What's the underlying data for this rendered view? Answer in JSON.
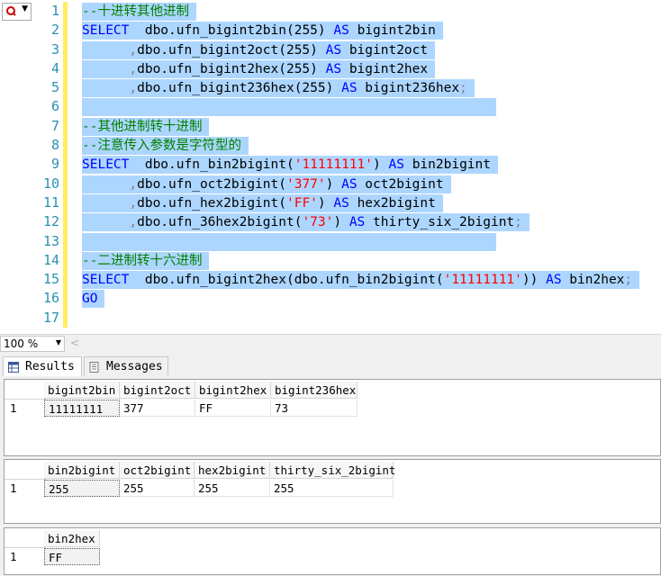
{
  "editor": {
    "lines": [
      {
        "n": "1",
        "segments": [
          {
            "t": "--十进转其他进制",
            "c": "cm"
          }
        ]
      },
      {
        "n": "2",
        "segments": [
          {
            "t": "SELECT",
            "c": "kw"
          },
          {
            "t": "  dbo.ufn_bigint2bin(255) ",
            "c": ""
          },
          {
            "t": "AS",
            "c": "kw"
          },
          {
            "t": " bigint2bin",
            "c": ""
          }
        ]
      },
      {
        "n": "3",
        "segments": [
          {
            "t": "      ,",
            "c": "op"
          },
          {
            "t": "dbo.ufn_bigint2oct(255) ",
            "c": ""
          },
          {
            "t": "AS",
            "c": "kw"
          },
          {
            "t": " bigint2oct",
            "c": ""
          }
        ]
      },
      {
        "n": "4",
        "segments": [
          {
            "t": "      ,",
            "c": "op"
          },
          {
            "t": "dbo.ufn_bigint2hex(255) ",
            "c": ""
          },
          {
            "t": "AS",
            "c": "kw"
          },
          {
            "t": " bigint2hex",
            "c": ""
          }
        ]
      },
      {
        "n": "5",
        "segments": [
          {
            "t": "      ,",
            "c": "op"
          },
          {
            "t": "dbo.ufn_bigint236hex(255) ",
            "c": ""
          },
          {
            "t": "AS",
            "c": "kw"
          },
          {
            "t": " bigint236hex",
            "c": ""
          },
          {
            "t": ";",
            "c": "op"
          }
        ]
      },
      {
        "n": "6",
        "segments": []
      },
      {
        "n": "7",
        "segments": [
          {
            "t": "--其他进制转十进制",
            "c": "cm"
          }
        ]
      },
      {
        "n": "8",
        "segments": [
          {
            "t": "--注意传入参数是字符型的",
            "c": "cm"
          }
        ]
      },
      {
        "n": "9",
        "segments": [
          {
            "t": "SELECT",
            "c": "kw"
          },
          {
            "t": "  dbo.ufn_bin2bigint(",
            "c": ""
          },
          {
            "t": "'11111111'",
            "c": "str"
          },
          {
            "t": ") ",
            "c": ""
          },
          {
            "t": "AS",
            "c": "kw"
          },
          {
            "t": " bin2bigint",
            "c": ""
          }
        ]
      },
      {
        "n": "10",
        "segments": [
          {
            "t": "      ,",
            "c": "op"
          },
          {
            "t": "dbo.ufn_oct2bigint(",
            "c": ""
          },
          {
            "t": "'377'",
            "c": "str"
          },
          {
            "t": ") ",
            "c": ""
          },
          {
            "t": "AS",
            "c": "kw"
          },
          {
            "t": " oct2bigint",
            "c": ""
          }
        ]
      },
      {
        "n": "11",
        "segments": [
          {
            "t": "      ,",
            "c": "op"
          },
          {
            "t": "dbo.ufn_hex2bigint(",
            "c": ""
          },
          {
            "t": "'FF'",
            "c": "str"
          },
          {
            "t": ") ",
            "c": ""
          },
          {
            "t": "AS",
            "c": "kw"
          },
          {
            "t": " hex2bigint",
            "c": ""
          }
        ]
      },
      {
        "n": "12",
        "segments": [
          {
            "t": "      ,",
            "c": "op"
          },
          {
            "t": "dbo.ufn_36hex2bigint(",
            "c": ""
          },
          {
            "t": "'73'",
            "c": "str"
          },
          {
            "t": ") ",
            "c": ""
          },
          {
            "t": "AS",
            "c": "kw"
          },
          {
            "t": " thirty_six_2bigint",
            "c": ""
          },
          {
            "t": ";",
            "c": "op"
          }
        ]
      },
      {
        "n": "13",
        "segments": []
      },
      {
        "n": "14",
        "segments": [
          {
            "t": "--二进制转十六进制",
            "c": "cm"
          }
        ]
      },
      {
        "n": "15",
        "segments": [
          {
            "t": "SELECT",
            "c": "kw"
          },
          {
            "t": "  dbo.ufn_bigint2hex(dbo.ufn_bin2bigint(",
            "c": ""
          },
          {
            "t": "'11111111'",
            "c": "str"
          },
          {
            "t": ")) ",
            "c": ""
          },
          {
            "t": "AS",
            "c": "kw"
          },
          {
            "t": " bin2hex",
            "c": ""
          },
          {
            "t": ";",
            "c": "op"
          }
        ]
      },
      {
        "n": "16",
        "segments": [
          {
            "t": "GO",
            "c": "kw"
          }
        ]
      },
      {
        "n": "17",
        "segments": []
      }
    ],
    "selected_through_line": "16"
  },
  "zoom": {
    "value": "100 %"
  },
  "tabs": {
    "results": "Results",
    "messages": "Messages"
  },
  "grids": [
    {
      "columns": [
        "bigint2bin",
        "bigint2oct",
        "bigint2hex",
        "bigint236hex"
      ],
      "rows": [
        {
          "num": "1",
          "cells": [
            "11111111",
            "377",
            "FF",
            "73"
          ]
        }
      ]
    },
    {
      "columns": [
        "bin2bigint",
        "oct2bigint",
        "hex2bigint",
        "thirty_six_2bigint"
      ],
      "rows": [
        {
          "num": "1",
          "cells": [
            "255",
            "255",
            "255",
            "255"
          ]
        }
      ]
    },
    {
      "columns": [
        "bin2hex"
      ],
      "rows": [
        {
          "num": "1",
          "cells": [
            "FF"
          ]
        }
      ]
    }
  ],
  "colors": {
    "selection": "#add6ff",
    "keyword": "#0000ff",
    "comment": "#008000",
    "string": "#ff0000",
    "line_number": "#2b91af",
    "change_marker": "#ffee62"
  }
}
